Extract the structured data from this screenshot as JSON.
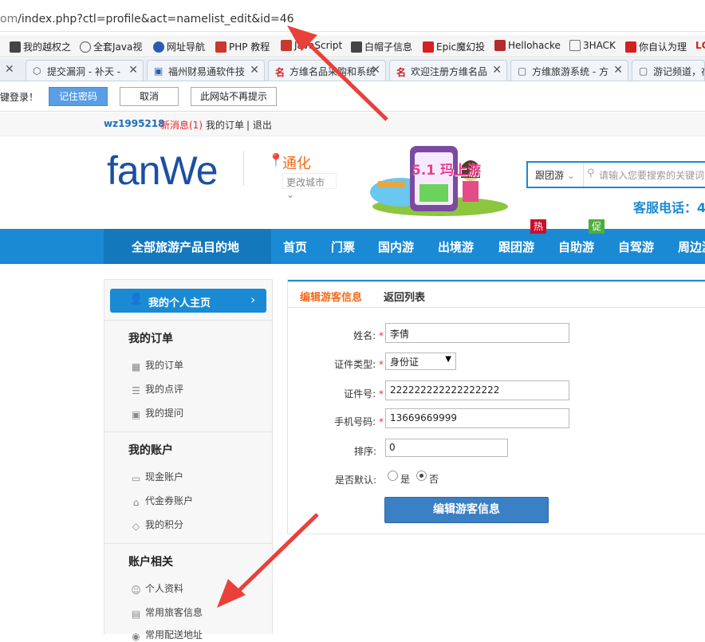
{
  "browser": {
    "url_prefix": "om",
    "url_path": "/index.php?ctl=profile&act=namelist_edit&id=46",
    "bookmarks": [
      "我的越权之",
      "全套Java视",
      "网址导航",
      "PHP 教程",
      "JavaScript",
      "白帽子信息",
      "Epic魔幻投",
      "Hellohacke",
      "3HACK",
      "你自认为理",
      "LC"
    ],
    "tabs": [
      "提交漏洞 - 补天 -",
      "福州财易通软件技",
      "方维名品采购和系统",
      "欢迎注册方维名品",
      "方维旅游系统 - 方",
      "游记频道，在"
    ],
    "password_prompt": "键登录！",
    "password_buttons": {
      "remember": "记住密码",
      "cancel": "取消",
      "never": "此网站不再提示"
    }
  },
  "userbar": {
    "username": "wz1995218",
    "new_msg": "新消息(1)",
    "my_orders": "我的订单",
    "logout": "| 退出"
  },
  "header": {
    "logo": "fanWe",
    "city": "通化",
    "change_city": "更改城市",
    "banner_text": "5.1 玛上游",
    "search_category": "跟团游",
    "search_placeholder": "请输入您要搜索的关键词",
    "hotline": "客服电话：4"
  },
  "nav": {
    "all_dest": "全部旅游产品目的地",
    "items": [
      "首页",
      "门票",
      "国内游",
      "出境游",
      "跟团游",
      "自助游",
      "自驾游",
      "周边游"
    ],
    "badge_hot": "热",
    "badge_promo": "促"
  },
  "sidebar": {
    "home": "我的个人主页",
    "section_orders": "我的订单",
    "orders": [
      "我的订单",
      "我的点评",
      "我的提问"
    ],
    "section_account": "我的账户",
    "account": [
      "现金账户",
      "代金券账户",
      "我的积分"
    ],
    "section_related": "账户相关",
    "related": [
      "个人资料",
      "常用旅客信息",
      "常用配送地址"
    ]
  },
  "form": {
    "tab_active": "编辑游客信息",
    "tab_back": "返回列表",
    "name_label": "姓名:",
    "name_value": "李倩",
    "idtype_label": "证件类型:",
    "idtype_value": "身份证",
    "idno_label": "证件号:",
    "idno_value": "222222222222222222",
    "phone_label": "手机号码:",
    "phone_value": "13669669999",
    "sort_label": "排序:",
    "sort_value": "0",
    "default_label": "是否默认:",
    "opt_yes": "是",
    "opt_no": "否",
    "submit": "编辑游客信息",
    "required_mark": "*"
  },
  "colors": {
    "nav_blue": "#1a8ad4",
    "orange": "#f26b1d",
    "submit_blue": "#3b7fc4",
    "arrow_red": "#e9403a"
  }
}
